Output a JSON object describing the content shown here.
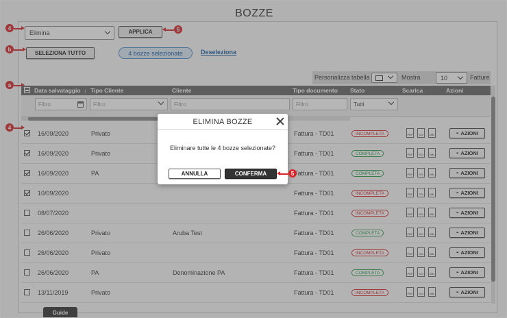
{
  "page": {
    "title": "BOZZE"
  },
  "action_bar": {
    "action_select": "Elimina",
    "apply_label": "APPLICA",
    "select_all_label": "SELEZIONA TUTTO",
    "selected_count_label": "4 bozze selezionate",
    "deselect_label": "Deseleziona"
  },
  "markers": {
    "a": "a",
    "b": "b",
    "four": "4",
    "five": "5"
  },
  "toolbar": {
    "customize_label": "Personalizza tabella",
    "show_label": "Mostra",
    "page_size": "10",
    "invoices_label": "Fatture"
  },
  "table": {
    "headers": {
      "date": "Data salvataggio",
      "sort_arrow": "↓",
      "client_type": "Tipo Cliente",
      "client": "Cliente",
      "doc_type": "Tipo documento",
      "status": "Stato",
      "download": "Scarica",
      "actions": "Azioni"
    },
    "filters": {
      "date_placeholder": "Filtro",
      "client_type_placeholder": "Filtro",
      "client_placeholder": "Filtro",
      "doc_type_placeholder": "Filtro",
      "status_value": "Tutti"
    },
    "download_icons": {
      "pdf": "PDF",
      "sdi": "SDI",
      "xml": "XML"
    },
    "actions_button": "AZIONI",
    "actions_dots": "•••",
    "rows": [
      {
        "checked": true,
        "date": "16/09/2020",
        "client_type": "Privato",
        "client": "",
        "doc_type": "Fattura - TD01",
        "status": "INCOMPLETA",
        "status_kind": "incompleta"
      },
      {
        "checked": true,
        "date": "16/09/2020",
        "client_type": "Privato",
        "client": "",
        "doc_type": "Fattura - TD01",
        "status": "COMPLETA",
        "status_kind": "completa"
      },
      {
        "checked": true,
        "date": "16/09/2020",
        "client_type": "PA",
        "client": "",
        "doc_type": "Fattura - TD01",
        "status": "COMPLETA",
        "status_kind": "completa"
      },
      {
        "checked": true,
        "date": "10/09/2020",
        "client_type": "",
        "client": "",
        "doc_type": "Fattura - TD01",
        "status": "INCOMPLETA",
        "status_kind": "incompleta"
      },
      {
        "checked": false,
        "date": "08/07/2020",
        "client_type": "",
        "client": "",
        "doc_type": "Fattura - TD01",
        "status": "INCOMPLETA",
        "status_kind": "incompleta"
      },
      {
        "checked": false,
        "date": "26/06/2020",
        "client_type": "Privato",
        "client": "Aruba Test",
        "doc_type": "Fattura - TD01",
        "status": "COMPLETA",
        "status_kind": "completa"
      },
      {
        "checked": false,
        "date": "26/06/2020",
        "client_type": "Privato",
        "client": "",
        "doc_type": "Fattura - TD01",
        "status": "INCOMPLETA",
        "status_kind": "incompleta"
      },
      {
        "checked": false,
        "date": "26/06/2020",
        "client_type": "PA",
        "client": "Denominazione PA",
        "doc_type": "Fattura - TD01",
        "status": "COMPLETA",
        "status_kind": "completa"
      },
      {
        "checked": false,
        "date": "13/11/2019",
        "client_type": "Privato",
        "client": "",
        "doc_type": "Fattura - TD01",
        "status": "INCOMPLETA",
        "status_kind": "incompleta"
      }
    ]
  },
  "modal": {
    "title": "ELIMINA BOZZE",
    "message": "Eliminare tutte le 4 bozze selezionate?",
    "cancel_label": "ANNULLA",
    "confirm_label": "CONFERMA"
  },
  "guide_label": "Guide",
  "colors": {
    "marker": "#d7262c",
    "header_bg": "#666666",
    "confirm_bg": "#333333",
    "pill_border": "#4a89c8"
  }
}
